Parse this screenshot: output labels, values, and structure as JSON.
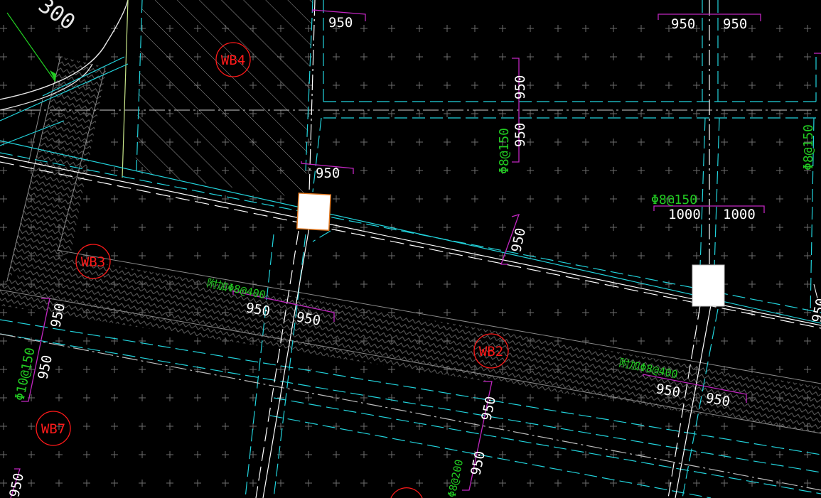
{
  "colors": {
    "background": "#000000",
    "white_lines": "#ffffff",
    "cyan_lines": "#22d3dc",
    "magenta_dims": "#c026c0",
    "green_text": "#22cc22",
    "red_labels": "#ff1a1a",
    "gray_hatch": "#8a8a8a",
    "grid_marks": "#6e6e6e"
  },
  "slab_labels": {
    "wb4": "WB4",
    "wb3": "WB3",
    "wb2": "WB2",
    "wb7": "WB7"
  },
  "rebar_labels": {
    "phi8_150_left": "Φ8@150",
    "phi8_150_right": "Φ8@150",
    "phi8_150_top": "Φ8@150",
    "phi10_150": "Φ10@150",
    "add_phi8_400_a": "附加Φ8@400",
    "add_phi8_400_b": "附加Φ8@400",
    "phi8_200": "Φ8@200"
  },
  "dimensions": {
    "d950_top_a": "950",
    "d950_top_b": "950",
    "d950_top_c": "950",
    "d950_vert_a": "950",
    "d950_vert_b": "950",
    "d950_mid": "950",
    "d1000_a": "1000",
    "d1000_b": "1000",
    "d950_diag": "950",
    "d950_b1": "950",
    "d950_b2": "950",
    "d950_c1": "950",
    "d950_c2": "950",
    "d950_left_a": "950",
    "d950_left_b": "950",
    "d950_bot_a": "950",
    "d950_bot_b": "950",
    "d950_corner": "950",
    "d950_right_edge": "950",
    "radius_label": "300"
  }
}
